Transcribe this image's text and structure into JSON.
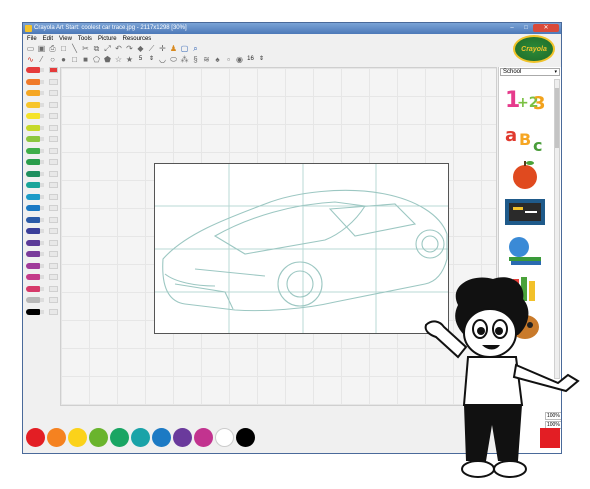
{
  "window": {
    "title": "Crayola Art Start: coolest car trace.jpg - 2117x1298 [30%]"
  },
  "window_controls": {
    "minimize": "–",
    "maximize": "□",
    "close": "✕"
  },
  "menu": [
    "File",
    "Edit",
    "View",
    "Tools",
    "Picture",
    "Resources"
  ],
  "toolbar": {
    "brush_size": "5",
    "stamp_size": "16"
  },
  "brand": {
    "logo_text": "Crayola"
  },
  "sidebar": {
    "category": "School",
    "thumbnails": [
      "numbers-sticker",
      "letters-sticker",
      "apple-sticker",
      "chalkboard-sticker",
      "books-sticker",
      "crayons-sticker",
      "mask-sticker"
    ],
    "zoom_1": "100%",
    "zoom_2": "100%"
  },
  "colors": {
    "accent": "#e31e24",
    "rail": [
      "#e53b3b",
      "#f07a2a",
      "#f5a623",
      "#f7c52b",
      "#f5e32a",
      "#c6d92a",
      "#8cc63f",
      "#3fae49",
      "#2a9d4b",
      "#1f8f5f",
      "#1aa59a",
      "#1c9bc8",
      "#1b79c4",
      "#2b5ba8",
      "#3a3f9a",
      "#5b3a98",
      "#7a3b9b",
      "#a03a9a",
      "#c43a8a",
      "#d63a6a",
      "#b8b8b8",
      "#000000"
    ],
    "bottom_palette": [
      "#e31e24",
      "#f58220",
      "#fbd21a",
      "#6ab42d",
      "#19a563",
      "#1aa3a8",
      "#1c7ac4",
      "#6a3a9c",
      "#c2338f",
      "#ffffff",
      "#000000"
    ]
  }
}
